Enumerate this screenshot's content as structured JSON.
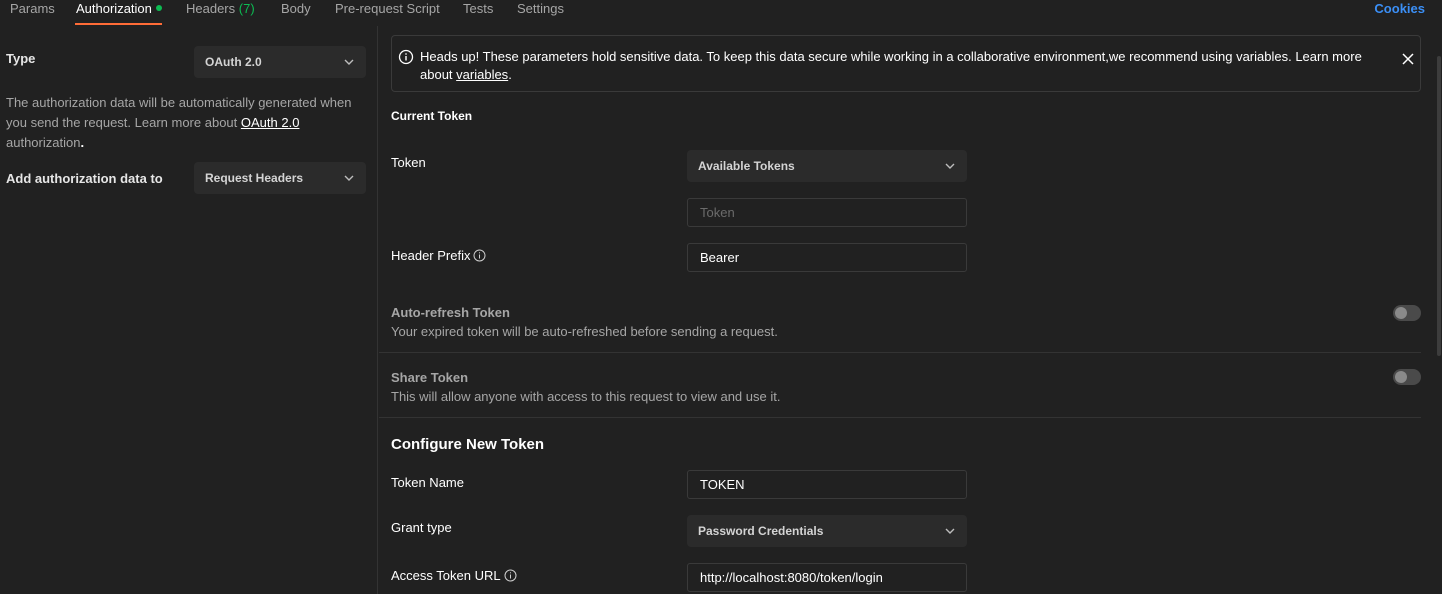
{
  "tabs": {
    "params": "Params",
    "authorization": "Authorization",
    "headers": "Headers",
    "headers_count": "(7)",
    "body": "Body",
    "prerequest": "Pre-request Script",
    "tests": "Tests",
    "settings": "Settings",
    "cookies": "Cookies"
  },
  "left": {
    "type_label": "Type",
    "type_value": "OAuth 2.0",
    "desc_1": "The authorization data will be automatically generated when you send the request. Learn more about ",
    "desc_link": "OAuth 2.0",
    "desc_2": "authorization",
    "desc_3": ".",
    "add_label": "Add authorization data to",
    "add_value": "Request Headers"
  },
  "banner": {
    "text": "Heads up! These parameters hold sensitive data. To keep this data secure while working in a collaborative environment,we recommend using variables. Learn more about ",
    "link": "variables",
    "end": "."
  },
  "current_token": {
    "title": "Current Token",
    "token_label": "Token",
    "token_select": "Available Tokens",
    "token_placeholder": "Token",
    "prefix_label": "Header Prefix",
    "prefix_value": "Bearer",
    "autorefresh_title": "Auto-refresh Token",
    "autorefresh_desc": "Your expired token will be auto-refreshed before sending a request.",
    "share_title": "Share Token",
    "share_desc": "This will allow anyone with access to this request to view and use it."
  },
  "new_token": {
    "title": "Configure New Token",
    "name_label": "Token Name",
    "name_value": "TOKEN",
    "grant_label": "Grant type",
    "grant_value": "Password Credentials",
    "url_label": "Access Token URL",
    "url_value": "http://localhost:8080/token/login"
  },
  "colors": {
    "accent": "#ff6c37",
    "success": "#0cbb52",
    "link": "#3b8ff6",
    "background": "#212121"
  }
}
